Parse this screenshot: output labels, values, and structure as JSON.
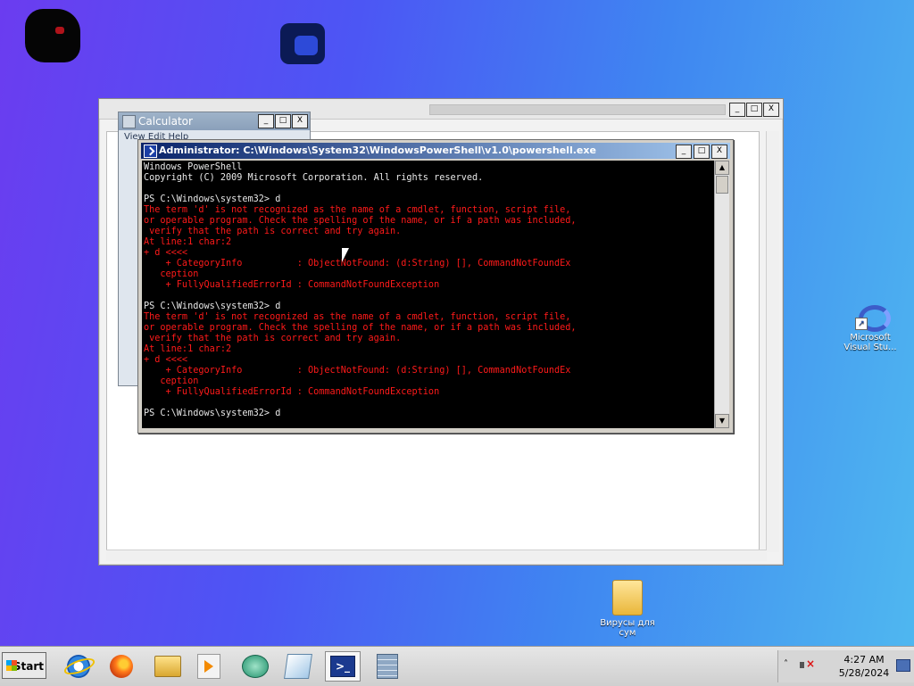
{
  "desktop": {
    "icons": [
      {
        "label": "Microsoft Visual Stu...",
        "icon": "visual-studio-icon"
      },
      {
        "label": "Вирусы для сум",
        "icon": "folder-icon"
      }
    ]
  },
  "background_window": {
    "buttons": {
      "minimize": "_",
      "maximize": "□",
      "close": "X"
    }
  },
  "calculator": {
    "title": "Calculator",
    "menu": "View  Edit  Help",
    "buttons": {
      "minimize": "_",
      "maximize": "□",
      "close": "X"
    }
  },
  "powershell": {
    "title": "Administrator: C:\\Windows\\System32\\WindowsPowerShell\\v1.0\\powershell.exe",
    "buttons": {
      "minimize": "_",
      "maximize": "□",
      "close": "X"
    },
    "console_lines": [
      {
        "text": "Windows PowerShell",
        "style": "normal"
      },
      {
        "text": "Copyright (C) 2009 Microsoft Corporation. All rights reserved.",
        "style": "normal"
      },
      {
        "text": "",
        "style": "normal"
      },
      {
        "text": "PS C:\\Windows\\system32> d",
        "style": "normal"
      },
      {
        "text": "The term 'd' is not recognized as the name of a cmdlet, function, script file,",
        "style": "error"
      },
      {
        "text": "or operable program. Check the spelling of the name, or if a path was included,",
        "style": "error"
      },
      {
        "text": " verify that the path is correct and try again.",
        "style": "error"
      },
      {
        "text": "At line:1 char:2",
        "style": "error"
      },
      {
        "text": "+ d <<<<",
        "style": "error"
      },
      {
        "text": "    + CategoryInfo          : ObjectNotFound: (d:String) [], CommandNotFoundEx",
        "style": "error"
      },
      {
        "text": "   ception",
        "style": "error"
      },
      {
        "text": "    + FullyQualifiedErrorId : CommandNotFoundException",
        "style": "error"
      },
      {
        "text": "",
        "style": "normal"
      },
      {
        "text": "PS C:\\Windows\\system32> d",
        "style": "normal"
      },
      {
        "text": "The term 'd' is not recognized as the name of a cmdlet, function, script file,",
        "style": "error"
      },
      {
        "text": "or operable program. Check the spelling of the name, or if a path was included,",
        "style": "error"
      },
      {
        "text": " verify that the path is correct and try again.",
        "style": "error"
      },
      {
        "text": "At line:1 char:2",
        "style": "error"
      },
      {
        "text": "+ d <<<<",
        "style": "error"
      },
      {
        "text": "    + CategoryInfo          : ObjectNotFound: (d:String) [], CommandNotFoundEx",
        "style": "error"
      },
      {
        "text": "   ception",
        "style": "error"
      },
      {
        "text": "    + FullyQualifiedErrorId : CommandNotFoundException",
        "style": "error"
      },
      {
        "text": "",
        "style": "normal"
      },
      {
        "text": "PS C:\\Windows\\system32> d",
        "style": "normal"
      }
    ],
    "colors": {
      "normal": "#e8e8e8",
      "error": "#ff1a1a",
      "background": "#000000"
    }
  },
  "taskbar": {
    "start_label": "Start",
    "items": [
      {
        "name": "internet-explorer",
        "icon": "ie-icon"
      },
      {
        "name": "firefox",
        "icon": "firefox-icon"
      },
      {
        "name": "windows-explorer",
        "icon": "folder-icon"
      },
      {
        "name": "media-player",
        "icon": "media-player-icon"
      },
      {
        "name": "chat-app",
        "icon": "chat-icon"
      },
      {
        "name": "notepad",
        "icon": "notepad-icon"
      },
      {
        "name": "powershell",
        "icon": "powershell-icon",
        "active": true
      },
      {
        "name": "calculator",
        "icon": "calculator-icon"
      }
    ],
    "powershell_glyph": ">_",
    "tray": {
      "chevron": "˄",
      "time": "4:27 AM",
      "date": "5/28/2024"
    }
  }
}
